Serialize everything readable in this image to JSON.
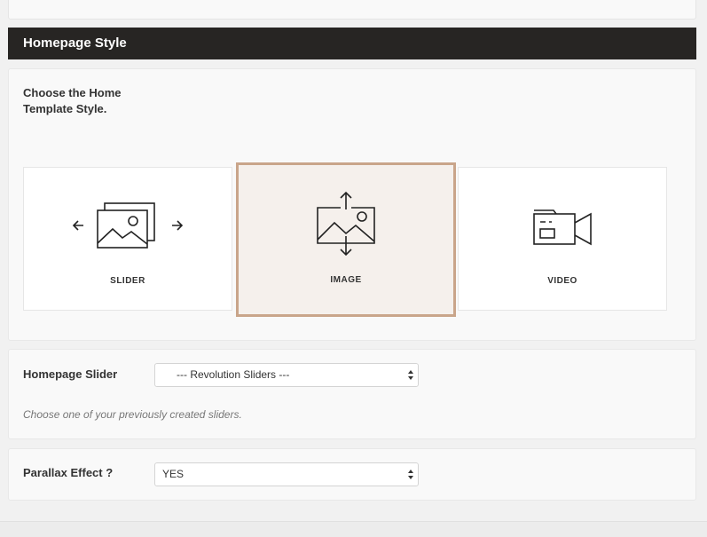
{
  "section": {
    "title": "Homepage Style"
  },
  "home_style": {
    "label": "Choose the Home Template Style.",
    "options": [
      {
        "caption": "SLIDER",
        "icon": "slider-images-icon",
        "selected": false
      },
      {
        "caption": "IMAGE",
        "icon": "image-arrows-icon",
        "selected": true
      },
      {
        "caption": "VIDEO",
        "icon": "video-camera-icon",
        "selected": false
      }
    ]
  },
  "homepage_slider": {
    "label": "Homepage Slider",
    "value": "--- Revolution Sliders ---",
    "help": "Choose one of your previously created sliders."
  },
  "parallax": {
    "label": "Parallax Effect ?",
    "value": "YES"
  },
  "colors": {
    "header_bg": "#272523",
    "selected_border": "#c9a58a",
    "selected_bg": "#f5f0ec"
  }
}
